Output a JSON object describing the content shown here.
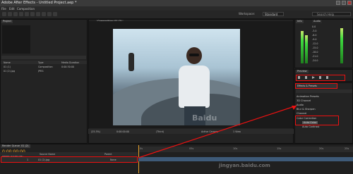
{
  "title_bar": {
    "title": "Adobe After Effects - Untitled Project.aep *"
  },
  "menu": {
    "items": [
      "File",
      "Edit",
      "Composition"
    ]
  },
  "toolbar": {
    "workspace_label": "Workspace:",
    "workspace_value": "Standard",
    "search_placeholder": "Search Help"
  },
  "project_panel": {
    "tab": "Project",
    "columns": [
      "Name",
      "Type",
      "Media Duration"
    ],
    "items": [
      {
        "name": "01 (1)",
        "type": "Composition",
        "duration": "0:00:30:00"
      },
      {
        "name": "01 (2).jpg",
        "type": "JPEG",
        "duration": ""
      }
    ]
  },
  "composition_panel": {
    "tab": "Composition: 01 (2)",
    "breadcrumb": "01 (2)",
    "zoom": "(25.3%)",
    "timecode": "0:00:00:00",
    "resolution": "(Third)",
    "camera": "Active Camera",
    "views": "1 View"
  },
  "info_panel": {
    "tabs": [
      "Info",
      "Audio"
    ],
    "db_values": [
      "0.0",
      "-3.0",
      "-6.0",
      "-9.0",
      "-12.0",
      "-15.0",
      "-18.0",
      "-21.0",
      "-24.0"
    ]
  },
  "preview_panel": {
    "title": "Preview"
  },
  "effects_panel": {
    "title": "Effects & Presets",
    "items": [
      "Animation Presets",
      "3D Channel",
      "Audio",
      "Blur & Sharpen",
      "Channel",
      "Color Correction",
      "Auto Color",
      "Auto Contrast"
    ]
  },
  "timeline": {
    "tabs": [
      "Render Queue",
      "01 (2)"
    ],
    "timecode": "0:00:00:00",
    "fps": "00000 (25.00 fps)",
    "columns": [
      "Source Name",
      "Parent"
    ],
    "layer_number": "1",
    "layer_name": "01 (2).jpg",
    "parent_value": "None",
    "ruler_ticks": [
      "0s",
      "05s",
      "10s",
      "15s",
      "20s",
      "25s"
    ]
  },
  "watermark": {
    "text": "Baidu",
    "url": "jingyan.baidu.com"
  },
  "colors": {
    "highlight": "#e11111",
    "accent": "#e8a12a"
  }
}
